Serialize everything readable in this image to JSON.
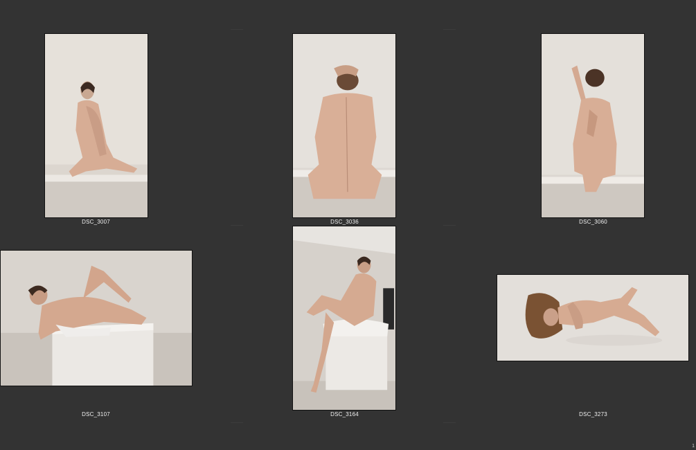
{
  "contact_sheet": {
    "items": [
      {
        "label": "DSC_3007",
        "pose": "seated-knees-up"
      },
      {
        "label": "DSC_3036",
        "pose": "seated-back-view"
      },
      {
        "label": "DSC_3060",
        "pose": "kneeling-back-view"
      },
      {
        "label": "DSC_3107",
        "pose": "reclining-on-cube"
      },
      {
        "label": "DSC_3164",
        "pose": "perched-on-cube"
      },
      {
        "label": "DSC_3273",
        "pose": "lying-on-floor"
      }
    ],
    "page_number": "1"
  },
  "colors": {
    "background": "#333333",
    "caption": "#f0f0f0"
  }
}
